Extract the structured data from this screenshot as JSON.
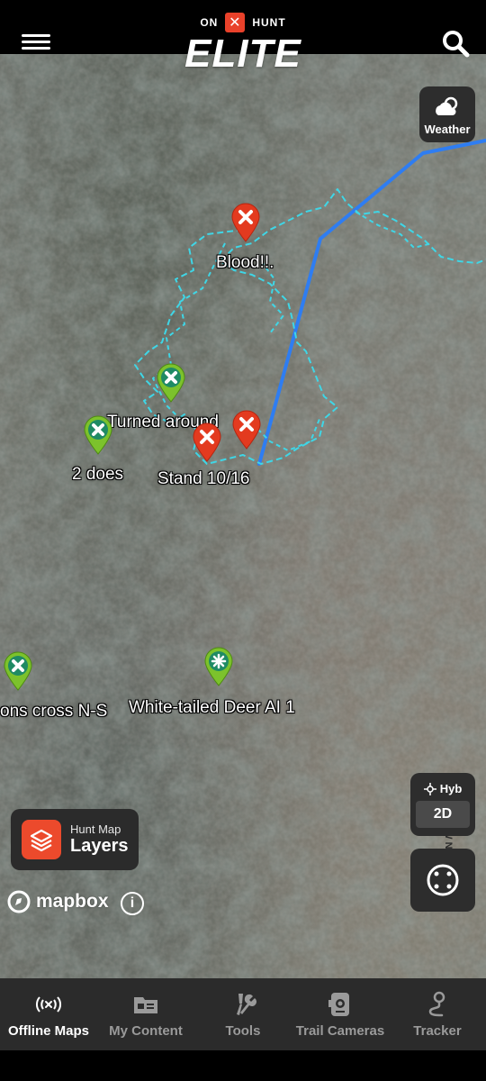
{
  "app": {
    "logo_prefix": "ON",
    "logo_suffix": "HUNT",
    "logo_x": "✕",
    "title": "ELITE"
  },
  "colors": {
    "accent": "#e9412a",
    "track_cyan": "#3fd6e6",
    "route_blue": "#2e7df2",
    "pin_red": "#e33a1f",
    "pin_green": "#7cc22c",
    "panel": "#2b2b2b"
  },
  "header": {
    "menu_icon": "hamburger-icon",
    "search_icon": "search-icon"
  },
  "weather": {
    "icon": "cloud-sun-icon",
    "label": "Weather"
  },
  "markers": [
    {
      "label": "Blood!!.",
      "color": "red",
      "icon": "x-icon"
    },
    {
      "label": "Turned around",
      "color": "green",
      "icon": "x-icon"
    },
    {
      "label": "2 does",
      "color": "green",
      "icon": "x-icon"
    },
    {
      "label": "Stand 10/16",
      "color": "red",
      "icon": "x-icon"
    },
    {
      "label": "",
      "color": "red",
      "icon": "x-icon"
    },
    {
      "label": "ons cross N-S",
      "color": "green",
      "icon": "x-icon"
    },
    {
      "label": "White-tailed Deer AI 1",
      "color": "green",
      "icon": "asterisk-icon"
    }
  ],
  "map_controls": {
    "basemap_label": "Hyb",
    "view_mode": "2D",
    "location_icon": "compass-icon"
  },
  "layers": {
    "sub_label": "Hunt Map",
    "label": "Layers"
  },
  "attribution": {
    "brand": "mapbox",
    "info": "i"
  },
  "road_label": "RIVERVIEW NA",
  "bottom_nav": [
    {
      "label": "Offline Maps",
      "icon": "offline-signal-icon",
      "active": true
    },
    {
      "label": "My Content",
      "icon": "id-card-icon",
      "active": false
    },
    {
      "label": "Tools",
      "icon": "tools-icon",
      "active": false
    },
    {
      "label": "Trail Cameras",
      "icon": "trail-camera-icon",
      "active": false
    },
    {
      "label": "Tracker",
      "icon": "tracker-pin-icon",
      "active": false
    }
  ]
}
